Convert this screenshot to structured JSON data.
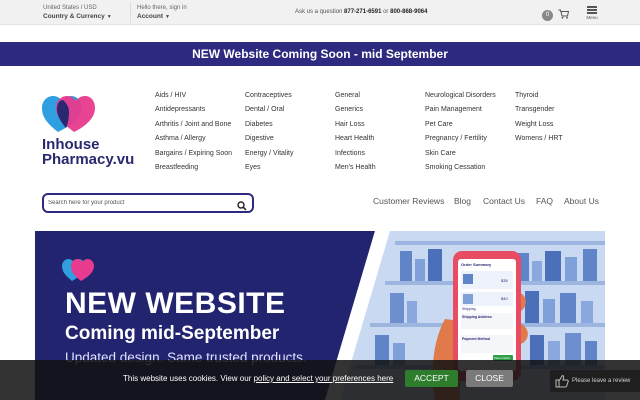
{
  "topbar": {
    "region_small": "United States / USD",
    "region_label": "Country & Currency",
    "account_small": "Hello there, sign in",
    "account_label": "Account",
    "ask_prefix": "Ask us a question",
    "phone1": "877-271-6591",
    "or": "or",
    "phone2": "800-868-9064",
    "cart_count": "0",
    "menu_label": "Menu"
  },
  "announcement": "NEW Website Coming Soon - mid September",
  "logo": {
    "line1": "Inhouse",
    "line2": "Pharmacy.vu"
  },
  "categories": [
    [
      "Aids / HIV",
      "Antidepressants",
      "Arthritis / Joint and Bone",
      "Asthma / Allergy",
      "Bargains / Expiring Soon",
      "Breastfeeding"
    ],
    [
      "Contraceptives",
      "Dental / Oral",
      "Diabetes",
      "Digestive",
      "Energy / Vitality",
      "Eyes"
    ],
    [
      "General",
      "Generics",
      "Hair Loss",
      "Heart Health",
      "Infections",
      "Men's Health"
    ],
    [
      "Neurological Disorders",
      "Pain Management",
      "Pet Care",
      "Pregnancy / Fertility",
      "Skin Care",
      "Smoking Cessation"
    ],
    [
      "Thyroid",
      "Transgender",
      "Weight Loss",
      "Womens / HRT"
    ]
  ],
  "search": {
    "placeholder": "Search here for your product"
  },
  "nav": {
    "reviews": "Customer Reviews",
    "blog": "Blog",
    "contact": "Contact Us",
    "faq": "FAQ",
    "about": "About Us"
  },
  "banner": {
    "title": "NEW WEBSITE",
    "subtitle": "Coming mid-September",
    "tagline": "Updated design. Same trusted products."
  },
  "phone_screen": {
    "summary": "Order Summary",
    "price1": "$35",
    "price2": "$40",
    "shipping_label": "Shipping",
    "shipping_address": "Shipping Address",
    "payment_method": "Payment Method",
    "place_order": "Place Order"
  },
  "cookie": {
    "text": "This website uses cookies. View our",
    "link": "policy and select your preferences here",
    "accept": "ACCEPT",
    "close": "CLOSE"
  },
  "review_widget": "Please leave a review",
  "colors": {
    "brand": "#2e2a7f",
    "accept": "#2d7d2d",
    "heart_pink": "#e83a8e",
    "heart_blue": "#2f6bd8"
  }
}
